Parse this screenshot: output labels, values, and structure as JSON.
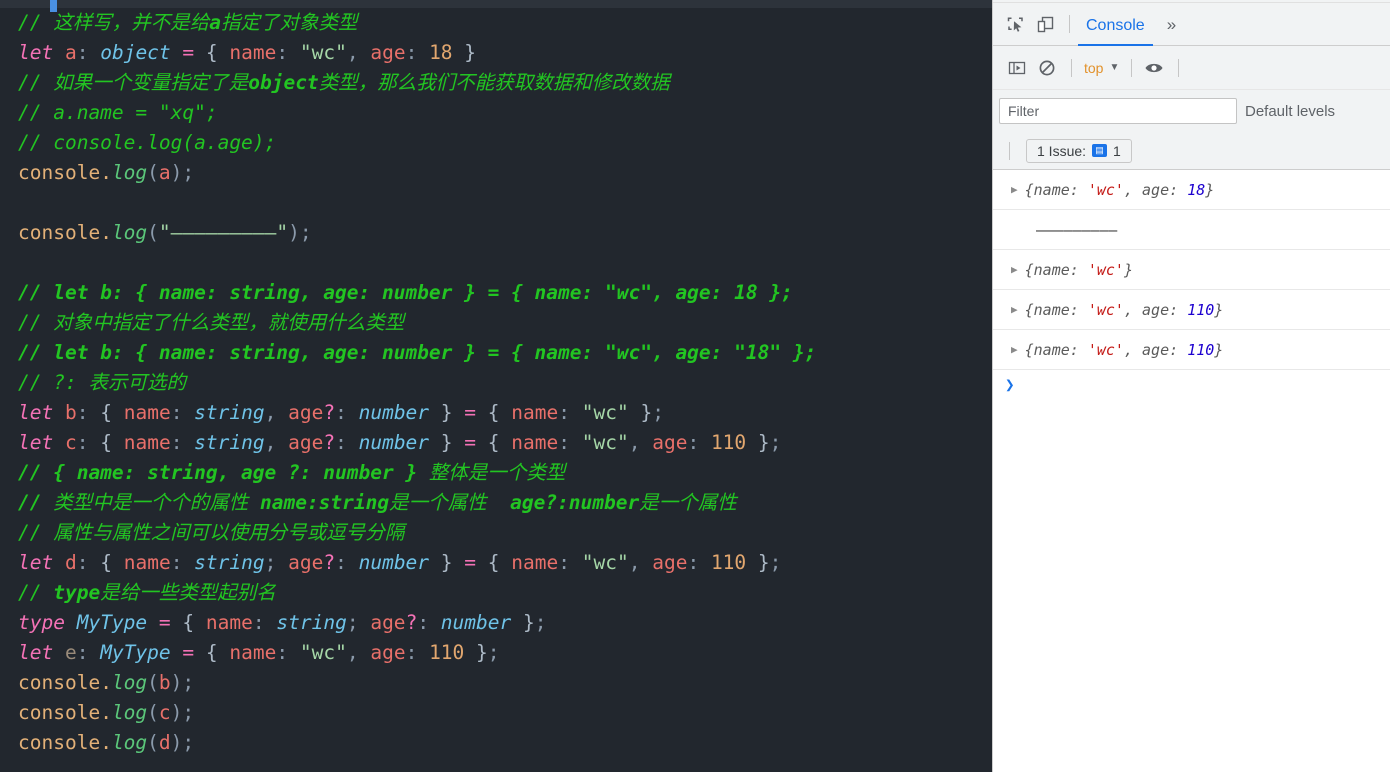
{
  "editor": {
    "lines": [
      {
        "id": 1,
        "tokens": [
          {
            "t": "// 这样写，并不是给",
            "c": "cm"
          },
          {
            "t": "a",
            "c": "cmb"
          },
          {
            "t": "指定了对象类型",
            "c": "cm"
          }
        ]
      },
      {
        "id": 2,
        "tokens": [
          {
            "t": "let",
            "c": "kw"
          },
          {
            "t": " ",
            "c": "pun"
          },
          {
            "t": "a",
            "c": "var"
          },
          {
            "t": ": ",
            "c": "pun2"
          },
          {
            "t": "object",
            "c": "typ"
          },
          {
            "t": " ",
            "c": "pun"
          },
          {
            "t": "=",
            "c": "op"
          },
          {
            "t": " ",
            "c": "pun"
          },
          {
            "t": "{",
            "c": "pun"
          },
          {
            "t": " ",
            "c": "pun"
          },
          {
            "t": "name",
            "c": "prop"
          },
          {
            "t": ": ",
            "c": "pun2"
          },
          {
            "t": "\"wc\"",
            "c": "str"
          },
          {
            "t": ",",
            "c": "pun2"
          },
          {
            "t": " ",
            "c": "pun"
          },
          {
            "t": "age",
            "c": "prop"
          },
          {
            "t": ": ",
            "c": "pun2"
          },
          {
            "t": "18",
            "c": "num"
          },
          {
            "t": " ",
            "c": "pun"
          },
          {
            "t": "}",
            "c": "pun"
          }
        ]
      },
      {
        "id": 3,
        "tokens": [
          {
            "t": "// 如果一个变量指定了是",
            "c": "cm"
          },
          {
            "t": "object",
            "c": "cmb"
          },
          {
            "t": "类型，那么我们不能获取数据和修改数据",
            "c": "cm"
          }
        ]
      },
      {
        "id": 4,
        "tokens": [
          {
            "t": "// a.name = \"xq\";",
            "c": "cm"
          }
        ]
      },
      {
        "id": 5,
        "tokens": [
          {
            "t": "// console.log(a.age);",
            "c": "cm"
          }
        ]
      },
      {
        "id": 6,
        "tokens": [
          {
            "t": "console",
            "c": "obj"
          },
          {
            "t": ".",
            "c": "obj"
          },
          {
            "t": "log",
            "c": "fn"
          },
          {
            "t": "(",
            "c": "pun2"
          },
          {
            "t": "a",
            "c": "var"
          },
          {
            "t": ")",
            "c": "pun2"
          },
          {
            "t": ";",
            "c": "pun2"
          }
        ]
      },
      {
        "id": 7,
        "tokens": []
      },
      {
        "id": 8,
        "tokens": [
          {
            "t": "console",
            "c": "obj"
          },
          {
            "t": ".",
            "c": "obj"
          },
          {
            "t": "log",
            "c": "fn"
          },
          {
            "t": "(",
            "c": "pun2"
          },
          {
            "t": "\"—————————\"",
            "c": "str"
          },
          {
            "t": ")",
            "c": "pun2"
          },
          {
            "t": ";",
            "c": "pun2"
          }
        ]
      },
      {
        "id": 9,
        "tokens": []
      },
      {
        "id": 10,
        "tokens": [
          {
            "t": "// let b: { name: string, age: number } = { name: \"wc\", age: 18 };",
            "c": "cmb"
          }
        ]
      },
      {
        "id": 11,
        "tokens": [
          {
            "t": "// 对象中指定了什么类型，就使用什么类型",
            "c": "cm"
          }
        ]
      },
      {
        "id": 12,
        "tokens": [
          {
            "t": "// let b: { name: string, age: number } = { name: \"wc\", age: \"18\" };",
            "c": "cmb"
          }
        ]
      },
      {
        "id": 13,
        "tokens": [
          {
            "t": "// ?: 表示可选的",
            "c": "cm"
          }
        ]
      },
      {
        "id": 14,
        "tokens": [
          {
            "t": "let",
            "c": "kw"
          },
          {
            "t": " ",
            "c": "pun"
          },
          {
            "t": "b",
            "c": "var"
          },
          {
            "t": ": ",
            "c": "pun2"
          },
          {
            "t": "{",
            "c": "pun"
          },
          {
            "t": " ",
            "c": "pun"
          },
          {
            "t": "name",
            "c": "prop"
          },
          {
            "t": ": ",
            "c": "pun2"
          },
          {
            "t": "string",
            "c": "typ"
          },
          {
            "t": ",",
            "c": "pun2"
          },
          {
            "t": " ",
            "c": "pun"
          },
          {
            "t": "age",
            "c": "prop"
          },
          {
            "t": "?",
            "c": "q"
          },
          {
            "t": ": ",
            "c": "pun2"
          },
          {
            "t": "number",
            "c": "typ"
          },
          {
            "t": " ",
            "c": "pun"
          },
          {
            "t": "}",
            "c": "pun"
          },
          {
            "t": " ",
            "c": "pun"
          },
          {
            "t": "=",
            "c": "op"
          },
          {
            "t": " ",
            "c": "pun"
          },
          {
            "t": "{",
            "c": "pun"
          },
          {
            "t": " ",
            "c": "pun"
          },
          {
            "t": "name",
            "c": "prop"
          },
          {
            "t": ": ",
            "c": "pun2"
          },
          {
            "t": "\"wc\"",
            "c": "str"
          },
          {
            "t": " ",
            "c": "pun"
          },
          {
            "t": "}",
            "c": "pun"
          },
          {
            "t": ";",
            "c": "pun2"
          }
        ]
      },
      {
        "id": 15,
        "tokens": [
          {
            "t": "let",
            "c": "kw"
          },
          {
            "t": " ",
            "c": "pun"
          },
          {
            "t": "c",
            "c": "var"
          },
          {
            "t": ": ",
            "c": "pun2"
          },
          {
            "t": "{",
            "c": "pun"
          },
          {
            "t": " ",
            "c": "pun"
          },
          {
            "t": "name",
            "c": "prop"
          },
          {
            "t": ": ",
            "c": "pun2"
          },
          {
            "t": "string",
            "c": "typ"
          },
          {
            "t": ",",
            "c": "pun2"
          },
          {
            "t": " ",
            "c": "pun"
          },
          {
            "t": "age",
            "c": "prop"
          },
          {
            "t": "?",
            "c": "q"
          },
          {
            "t": ": ",
            "c": "pun2"
          },
          {
            "t": "number",
            "c": "typ"
          },
          {
            "t": " ",
            "c": "pun"
          },
          {
            "t": "}",
            "c": "pun"
          },
          {
            "t": " ",
            "c": "pun"
          },
          {
            "t": "=",
            "c": "op"
          },
          {
            "t": " ",
            "c": "pun"
          },
          {
            "t": "{",
            "c": "pun"
          },
          {
            "t": " ",
            "c": "pun"
          },
          {
            "t": "name",
            "c": "prop"
          },
          {
            "t": ": ",
            "c": "pun2"
          },
          {
            "t": "\"wc\"",
            "c": "str"
          },
          {
            "t": ",",
            "c": "pun2"
          },
          {
            "t": " ",
            "c": "pun"
          },
          {
            "t": "age",
            "c": "prop"
          },
          {
            "t": ": ",
            "c": "pun2"
          },
          {
            "t": "110",
            "c": "num"
          },
          {
            "t": " ",
            "c": "pun"
          },
          {
            "t": "}",
            "c": "pun"
          },
          {
            "t": ";",
            "c": "pun2"
          }
        ]
      },
      {
        "id": 16,
        "tokens": [
          {
            "t": "// { name: string, age ?: number } ",
            "c": "cmb"
          },
          {
            "t": "整体是一个类型",
            "c": "cm"
          }
        ]
      },
      {
        "id": 17,
        "tokens": [
          {
            "t": "// ",
            "c": "cmb"
          },
          {
            "t": "类型中是一个个的属性 ",
            "c": "cm"
          },
          {
            "t": "name:string",
            "c": "cmb"
          },
          {
            "t": "是一个属性  ",
            "c": "cm"
          },
          {
            "t": "age?:number",
            "c": "cmb"
          },
          {
            "t": "是一个属性",
            "c": "cm"
          }
        ]
      },
      {
        "id": 18,
        "tokens": [
          {
            "t": "// 属性与属性之间可以使用分号或逗号分隔",
            "c": "cm"
          }
        ]
      },
      {
        "id": 19,
        "tokens": [
          {
            "t": "let",
            "c": "kw"
          },
          {
            "t": " ",
            "c": "pun"
          },
          {
            "t": "d",
            "c": "var"
          },
          {
            "t": ": ",
            "c": "pun2"
          },
          {
            "t": "{",
            "c": "pun"
          },
          {
            "t": " ",
            "c": "pun"
          },
          {
            "t": "name",
            "c": "prop"
          },
          {
            "t": ": ",
            "c": "pun2"
          },
          {
            "t": "string",
            "c": "typ"
          },
          {
            "t": ";",
            "c": "pun2"
          },
          {
            "t": " ",
            "c": "pun"
          },
          {
            "t": "age",
            "c": "prop"
          },
          {
            "t": "?",
            "c": "q"
          },
          {
            "t": ": ",
            "c": "pun2"
          },
          {
            "t": "number",
            "c": "typ"
          },
          {
            "t": " ",
            "c": "pun"
          },
          {
            "t": "}",
            "c": "pun"
          },
          {
            "t": " ",
            "c": "pun"
          },
          {
            "t": "=",
            "c": "op"
          },
          {
            "t": " ",
            "c": "pun"
          },
          {
            "t": "{",
            "c": "pun"
          },
          {
            "t": " ",
            "c": "pun"
          },
          {
            "t": "name",
            "c": "prop"
          },
          {
            "t": ": ",
            "c": "pun2"
          },
          {
            "t": "\"wc\"",
            "c": "str"
          },
          {
            "t": ",",
            "c": "pun2"
          },
          {
            "t": " ",
            "c": "pun"
          },
          {
            "t": "age",
            "c": "prop"
          },
          {
            "t": ": ",
            "c": "pun2"
          },
          {
            "t": "110",
            "c": "num"
          },
          {
            "t": " ",
            "c": "pun"
          },
          {
            "t": "}",
            "c": "pun"
          },
          {
            "t": ";",
            "c": "pun2"
          }
        ]
      },
      {
        "id": 20,
        "tokens": [
          {
            "t": "// ",
            "c": "cm"
          },
          {
            "t": "type",
            "c": "cmb"
          },
          {
            "t": "是给一些类型起别名",
            "c": "cm"
          }
        ]
      },
      {
        "id": 21,
        "tokens": [
          {
            "t": "type",
            "c": "kw"
          },
          {
            "t": " ",
            "c": "pun"
          },
          {
            "t": "MyType",
            "c": "typ"
          },
          {
            "t": " ",
            "c": "pun"
          },
          {
            "t": "=",
            "c": "op"
          },
          {
            "t": " ",
            "c": "pun"
          },
          {
            "t": "{",
            "c": "pun"
          },
          {
            "t": " ",
            "c": "pun"
          },
          {
            "t": "name",
            "c": "prop"
          },
          {
            "t": ": ",
            "c": "pun2"
          },
          {
            "t": "string",
            "c": "typ"
          },
          {
            "t": ";",
            "c": "pun2"
          },
          {
            "t": " ",
            "c": "pun"
          },
          {
            "t": "age",
            "c": "prop"
          },
          {
            "t": "?",
            "c": "q"
          },
          {
            "t": ": ",
            "c": "pun2"
          },
          {
            "t": "number",
            "c": "typ"
          },
          {
            "t": " ",
            "c": "pun"
          },
          {
            "t": "}",
            "c": "pun"
          },
          {
            "t": ";",
            "c": "pun2"
          }
        ]
      },
      {
        "id": 22,
        "tokens": [
          {
            "t": "let",
            "c": "kw"
          },
          {
            "t": " ",
            "c": "pun"
          },
          {
            "t": "e",
            "c": "vard"
          },
          {
            "t": ": ",
            "c": "pun2"
          },
          {
            "t": "MyType",
            "c": "typ"
          },
          {
            "t": " ",
            "c": "pun"
          },
          {
            "t": "=",
            "c": "op"
          },
          {
            "t": " ",
            "c": "pun"
          },
          {
            "t": "{",
            "c": "pun"
          },
          {
            "t": " ",
            "c": "pun"
          },
          {
            "t": "name",
            "c": "prop"
          },
          {
            "t": ": ",
            "c": "pun2"
          },
          {
            "t": "\"wc\"",
            "c": "str"
          },
          {
            "t": ",",
            "c": "pun2"
          },
          {
            "t": " ",
            "c": "pun"
          },
          {
            "t": "age",
            "c": "prop"
          },
          {
            "t": ": ",
            "c": "pun2"
          },
          {
            "t": "110",
            "c": "num"
          },
          {
            "t": " ",
            "c": "pun"
          },
          {
            "t": "}",
            "c": "pun"
          },
          {
            "t": ";",
            "c": "pun2"
          }
        ]
      },
      {
        "id": 23,
        "tokens": [
          {
            "t": "console",
            "c": "obj"
          },
          {
            "t": ".",
            "c": "obj"
          },
          {
            "t": "log",
            "c": "fn"
          },
          {
            "t": "(",
            "c": "pun2"
          },
          {
            "t": "b",
            "c": "var"
          },
          {
            "t": ")",
            "c": "pun2"
          },
          {
            "t": ";",
            "c": "pun2"
          }
        ]
      },
      {
        "id": 24,
        "tokens": [
          {
            "t": "console",
            "c": "obj"
          },
          {
            "t": ".",
            "c": "obj"
          },
          {
            "t": "log",
            "c": "fn"
          },
          {
            "t": "(",
            "c": "pun2"
          },
          {
            "t": "c",
            "c": "var"
          },
          {
            "t": ")",
            "c": "pun2"
          },
          {
            "t": ";",
            "c": "pun2"
          }
        ]
      },
      {
        "id": 25,
        "tokens": [
          {
            "t": "console",
            "c": "obj"
          },
          {
            "t": ".",
            "c": "obj"
          },
          {
            "t": "log",
            "c": "fn"
          },
          {
            "t": "(",
            "c": "pun2"
          },
          {
            "t": "d",
            "c": "var"
          },
          {
            "t": ")",
            "c": "pun2"
          },
          {
            "t": ";",
            "c": "pun2"
          }
        ]
      }
    ]
  },
  "devtools": {
    "tabs": {
      "console_label": "Console",
      "more_label": "»"
    },
    "toolbar": {
      "context_label": "top",
      "context_carat": "▼"
    },
    "filter": {
      "placeholder": "Filter",
      "value": "",
      "levels_label": "Default levels"
    },
    "issues": {
      "label": "1 Issue:",
      "count": "1",
      "badge_glyph": "▤"
    },
    "console_rows": [
      {
        "kind": "object",
        "disclosure": "▶",
        "parts": [
          {
            "t": "{name: ",
            "c": "k"
          },
          {
            "t": "'wc'",
            "c": "s"
          },
          {
            "t": ", age: ",
            "c": "k"
          },
          {
            "t": "18",
            "c": "n"
          },
          {
            "t": "}",
            "c": "k"
          }
        ]
      },
      {
        "kind": "text",
        "disclosure": "",
        "text": "—————————"
      },
      {
        "kind": "object",
        "disclosure": "▶",
        "parts": [
          {
            "t": "{name: ",
            "c": "k"
          },
          {
            "t": "'wc'",
            "c": "s"
          },
          {
            "t": "}",
            "c": "k"
          }
        ]
      },
      {
        "kind": "object",
        "disclosure": "▶",
        "parts": [
          {
            "t": "{name: ",
            "c": "k"
          },
          {
            "t": "'wc'",
            "c": "s"
          },
          {
            "t": ", age: ",
            "c": "k"
          },
          {
            "t": "110",
            "c": "n"
          },
          {
            "t": "}",
            "c": "k"
          }
        ]
      },
      {
        "kind": "object",
        "disclosure": "▶",
        "parts": [
          {
            "t": "{name: ",
            "c": "k"
          },
          {
            "t": "'wc'",
            "c": "s"
          },
          {
            "t": ", age: ",
            "c": "k"
          },
          {
            "t": "110",
            "c": "n"
          },
          {
            "t": "}",
            "c": "k"
          }
        ]
      }
    ],
    "prompt": {
      "caret": "❯"
    }
  },
  "colors": {
    "editor_bg": "#22272e",
    "devtools_bg": "#ffffff",
    "toolbar_bg": "#f1f3f4",
    "accent_blue": "#1a73e8",
    "comment_green": "#22c522",
    "keyword_pink": "#f472b6",
    "type_blue": "#6fc3e8",
    "string_green": "#a5d6a7",
    "number_orange": "#e2a76f"
  }
}
